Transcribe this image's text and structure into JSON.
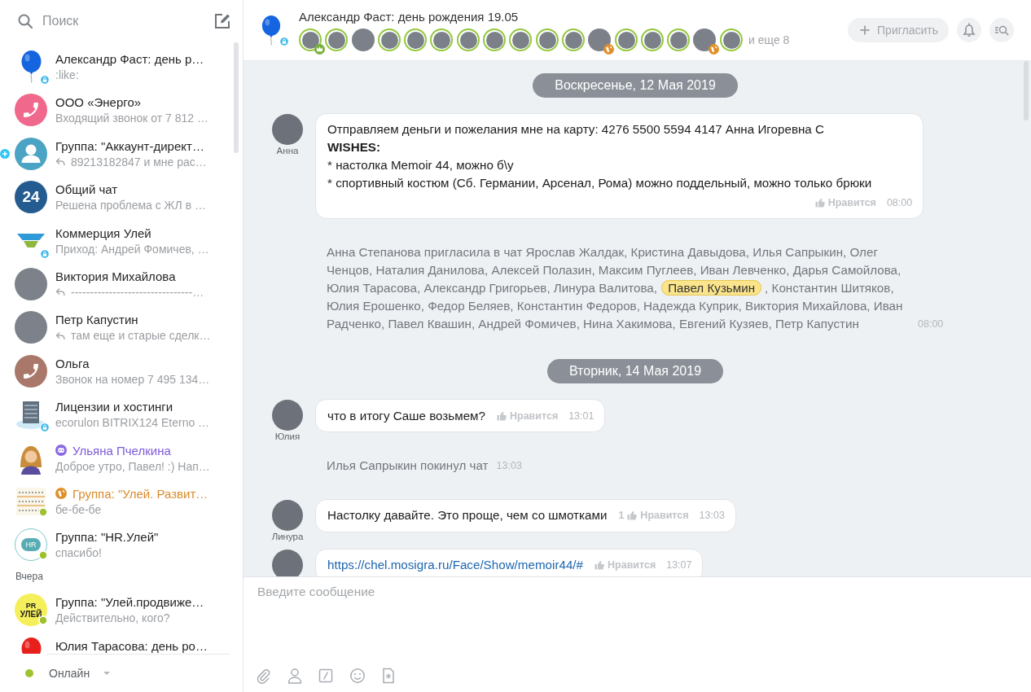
{
  "sidebar": {
    "search": {
      "placeholder": "Поиск"
    },
    "sections": [
      {
        "items": [
          {
            "title": "Александр Фаст: день р…",
            "subtitle": ":like:",
            "avatar": {
              "kind": "balloon",
              "color": "#1565e0"
            },
            "locked": true,
            "online": false,
            "reply": false,
            "plus_marker": false,
            "kind": "chat",
            "selected": false
          },
          {
            "title": "ООО «Энерго»",
            "subtitle": "Входящий звонок от 7 812 …",
            "avatar": {
              "kind": "phone",
              "color": "#f0698c"
            },
            "locked": false,
            "online": false,
            "reply": false,
            "plus_marker": false,
            "kind": "chat",
            "selected": false
          },
          {
            "title": "Группа: \"Аккаунт-директ…",
            "subtitle": "89213182847 и мне рас…",
            "avatar": {
              "kind": "person",
              "color": "#4ca4c4"
            },
            "locked": false,
            "online": false,
            "reply": true,
            "plus_marker": true,
            "kind": "chat",
            "selected": false
          },
          {
            "title": "Общий чат",
            "subtitle": "Решена проблема с ЖЛ в …",
            "avatar": {
              "kind": "text",
              "text": "24",
              "color": "#245c91"
            },
            "locked": false,
            "online": false,
            "reply": false,
            "plus_marker": false,
            "kind": "chat",
            "selected": false
          },
          {
            "title": "Коммерция Улей",
            "subtitle": "Приход: Андрей Фомичев, …",
            "avatar": {
              "kind": "funnel"
            },
            "locked": true,
            "online": false,
            "reply": false,
            "plus_marker": false,
            "kind": "chat",
            "selected": false
          },
          {
            "title": "Виктория Михайлова",
            "subtitle": "--------------------------------…",
            "avatar": {
              "kind": "photo"
            },
            "locked": false,
            "online": false,
            "reply": true,
            "plus_marker": false,
            "kind": "chat",
            "selected": false
          },
          {
            "title": "Петр Капустин",
            "subtitle": "там еще и старые сделк…",
            "avatar": {
              "kind": "photo"
            },
            "locked": false,
            "online": false,
            "reply": true,
            "plus_marker": false,
            "kind": "chat",
            "selected": false
          },
          {
            "title": "Ольга",
            "subtitle": "Звонок на номер 7 495 134…",
            "avatar": {
              "kind": "phone",
              "color": "#a9786a"
            },
            "locked": false,
            "online": false,
            "reply": false,
            "plus_marker": false,
            "kind": "chat",
            "selected": false
          },
          {
            "title": "Лицензии и хостинги",
            "subtitle": "ecorulon BITRIX124 Eterno …",
            "avatar": {
              "kind": "server"
            },
            "locked": true,
            "online": false,
            "reply": false,
            "plus_marker": false,
            "kind": "chat",
            "selected": false
          },
          {
            "title": "Ульяна Пчелкина",
            "subtitle": "Доброе утро, Павел! :) Нап…",
            "avatar": {
              "kind": "cartoon"
            },
            "locked": false,
            "online": false,
            "reply": false,
            "plus_marker": false,
            "kind": "bot",
            "selected": false
          },
          {
            "title": "Группа: \"Улей. Развит…",
            "subtitle": "бе-бе-бе",
            "avatar": {
              "kind": "pattern"
            },
            "locked": false,
            "online": true,
            "reply": false,
            "plus_marker": false,
            "kind": "open",
            "selected": false
          },
          {
            "title": "Группа: \"HR.Улей\"",
            "subtitle": "спасибо!",
            "avatar": {
              "kind": "cloud",
              "text": "HR"
            },
            "locked": false,
            "online": true,
            "reply": false,
            "plus_marker": false,
            "kind": "chat",
            "selected": false
          }
        ]
      },
      {
        "label": "Вчера",
        "items": [
          {
            "title": "Группа: \"Улей.продвиже…",
            "subtitle": "Действительно, кого?",
            "avatar": {
              "kind": "logo",
              "lines": [
                "PR",
                "УЛЕЙ"
              ],
              "color": "#f6ef5c"
            },
            "locked": false,
            "online": true,
            "reply": false,
            "plus_marker": false,
            "kind": "chat",
            "selected": false
          },
          {
            "title": "Юлия Тарасова: день ро…",
            "avatar": {
              "kind": "balloon",
              "color": "#e8201c"
            },
            "locked": false,
            "online": false,
            "reply": false,
            "plus_marker": false,
            "kind": "chat",
            "selected": false
          }
        ]
      }
    ],
    "status": {
      "label": "Онлайн",
      "color": "#9ec32f"
    }
  },
  "header": {
    "avatar": {
      "kind": "balloon",
      "color": "#1565e0"
    },
    "avatar_locked": true,
    "title": "Александр Фаст: день рождения 19.05",
    "members": [
      {
        "online": true,
        "owner": true,
        "external": false
      },
      {
        "online": true,
        "owner": false,
        "external": false
      },
      {
        "online": false,
        "owner": false,
        "external": false
      },
      {
        "online": true,
        "owner": false,
        "external": false
      },
      {
        "online": true,
        "owner": false,
        "external": false
      },
      {
        "online": true,
        "owner": false,
        "external": false
      },
      {
        "online": true,
        "owner": false,
        "external": false
      },
      {
        "online": true,
        "owner": false,
        "external": false
      },
      {
        "online": true,
        "owner": false,
        "external": false
      },
      {
        "online": true,
        "owner": false,
        "external": false
      },
      {
        "online": true,
        "owner": false,
        "external": false
      },
      {
        "online": false,
        "owner": false,
        "external": true
      },
      {
        "online": true,
        "owner": false,
        "external": false
      },
      {
        "online": true,
        "owner": false,
        "external": false
      },
      {
        "online": true,
        "owner": false,
        "external": false
      },
      {
        "online": false,
        "owner": false,
        "external": true
      },
      {
        "online": true,
        "owner": false,
        "external": false
      }
    ],
    "more": "и еще 8",
    "invite_button": "Пригласить"
  },
  "feed": {
    "items": [
      {
        "kind": "date",
        "text": "Воскресенье, 12 Мая 2019"
      },
      {
        "kind": "message",
        "author": "Анна",
        "lines": [
          {
            "text": "Отправляем деньги и пожелания мне на карту: 4276 5500 5594 4147 Анна Игоревна С",
            "kind": "text"
          },
          {
            "text": "WISHES:",
            "kind": "heading"
          },
          {
            "text": "* настолка Memoir 44, можно б\\у",
            "kind": "text"
          },
          {
            "text": "* спортивный костюм (Сб. Германии, Арсенал, Рома) можно поддельный, можно только брюки",
            "kind": "text"
          }
        ],
        "like": "Нравится",
        "time": "08:00"
      },
      {
        "kind": "system",
        "parts": [
          {
            "text": "Анна Степанова пригласила в чат Ярослав Жалдак, Кристина Давыдова, Илья Сапрыкин, Олег Ченцов, Наталия Данилова, Алексей Полазин, Максим Пуглеев, Иван Левченко, Дарья Самойлова, Юлия Тарасова, Александр Григорьев, Линура Валитова, ",
            "mention": false
          },
          {
            "text": "Павел Кузьмин",
            "mention": true
          },
          {
            "text": ", Константин Шитяков, Юлия Ерошенко, Федор Беляев, Константин Федоров, Надежда Куприк, Виктория Михайлова, Иван Радченко, Павел Квашин, Андрей Фомичев, Нина Хакимова, Евгений Кузяев, Петр Капустин",
            "mention": false
          }
        ],
        "time": "08:00"
      },
      {
        "kind": "date",
        "text": "Вторник, 14 Мая 2019"
      },
      {
        "kind": "message",
        "author": "Юлия",
        "lines": [
          {
            "text": "что в итогу Саше возьмем?",
            "kind": "text"
          }
        ],
        "like": "Нравится",
        "time": "13:01"
      },
      {
        "kind": "system",
        "parts": [
          {
            "text": "Илья Сапрыкин покинул чат",
            "mention": false
          }
        ],
        "time": "13:03"
      },
      {
        "kind": "message",
        "author": "Линура",
        "lines": [
          {
            "text": "Настолку давайте. Это проще, чем со шмотками",
            "kind": "text"
          }
        ],
        "like_count": "1",
        "like": "Нравится",
        "time": "13:03"
      },
      {
        "kind": "message",
        "lines": [
          {
            "text": "https://chel.mosigra.ru/Face/Show/memoir44/#",
            "kind": "link"
          }
        ],
        "like": "Нравится",
        "time": "13:07"
      }
    ]
  },
  "composer": {
    "placeholder": "Введите сообщение"
  }
}
